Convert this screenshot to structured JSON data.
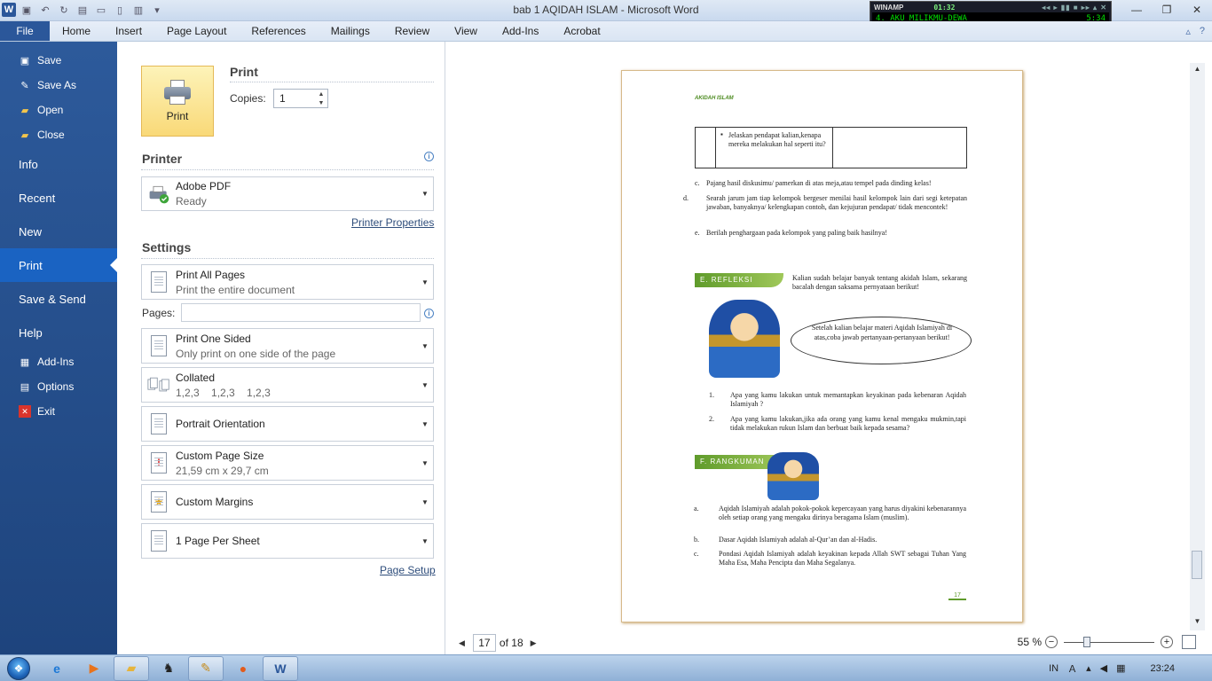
{
  "window": {
    "title": "bab 1 AQIDAH ISLAM  -  Microsoft Word",
    "app_icon": "W"
  },
  "winamp": {
    "label": "WINAMP",
    "time_top": "01:32",
    "track": "4. AKU MILIKMU-DEWA",
    "track_time": "5:34"
  },
  "ribbon": {
    "tabs": [
      "File",
      "Home",
      "Insert",
      "Page Layout",
      "References",
      "Mailings",
      "Review",
      "View",
      "Add-Ins",
      "Acrobat"
    ]
  },
  "nav": {
    "save": "Save",
    "save_as": "Save As",
    "open": "Open",
    "close": "Close",
    "info": "Info",
    "recent": "Recent",
    "new": "New",
    "print": "Print",
    "save_send": "Save & Send",
    "help": "Help",
    "add_ins": "Add-Ins",
    "options": "Options",
    "exit": "Exit"
  },
  "print": {
    "heading": "Print",
    "button_label": "Print",
    "copies_label": "Copies:",
    "copies_value": "1"
  },
  "printer": {
    "heading": "Printer",
    "name": "Adobe PDF",
    "status": "Ready",
    "properties_link": "Printer Properties"
  },
  "settings": {
    "heading": "Settings",
    "range_main": "Print All Pages",
    "range_sub": "Print the entire document",
    "pages_label": "Pages:",
    "pages_value": "",
    "sides_main": "Print One Sided",
    "sides_sub": "Only print on one side of the page",
    "collate_main": "Collated",
    "collate_sub": "1,2,3    1,2,3    1,2,3",
    "orientation_main": "Portrait Orientation",
    "size_main": "Custom Page Size",
    "size_sub": "21,59 cm x 29,7 cm",
    "margins_main": "Custom Margins",
    "persheet_main": "1 Page Per Sheet",
    "page_setup_link": "Page Setup"
  },
  "preview_page": {
    "header": "AKIDAH ISLAM",
    "table_cell": "Jelaskan pendapat kalian,kenapa mereka melakukan hal seperti itu?",
    "items": [
      {
        "m": "c.",
        "t": "Pajang hasil diskusimu/ pamerkan di atas meja,atau tempel pada dinding kelas!"
      },
      {
        "m": "d.",
        "t": "Searah jarum jam tiap kelompok bergeser menilai hasil kelompok lain dari segi ketepatan jawaban, banyaknya/ kelengkapan contoh, dan kejujuran pendapat/ tidak mencontek!"
      },
      {
        "m": "e.",
        "t": "Berilah penghargaan pada kelompok yang paling baik hasilnya!"
      }
    ],
    "refleksi_banner": "E. REFLEKSI",
    "refleksi_text": "Kalian sudah belajar banyak tentang akidah Islam, sekarang bacalah dengan saksama pernyataan berikut!",
    "bubble": "Setelah kalian belajar materi Aqidah Islamiyah di atas,coba jawab pertanyaan-pertanyaan berikut!",
    "questions": [
      {
        "n": "1.",
        "t": "Apa yang kamu lakukan untuk memantapkan keyakinan pada kebenaran Aqidah Islamiyah ?"
      },
      {
        "n": "2.",
        "t": "Apa yang kamu lakukan,jika ada orang yang kamu kenal mengaku mukmin,tapi tidak melakukan rukun Islam dan berbuat  baik kepada sesama?"
      }
    ],
    "rangkuman_banner": "F. RANGKUMAN",
    "summary": [
      {
        "m": "a.",
        "t": "Aqidah Islamiyah adalah pokok-pokok kepercayaan yang harus diyakini kebenarannya oleh setiap orang yang mengaku dirinya beragama Islam (muslim)."
      },
      {
        "m": "b.",
        "t": "Dasar Aqidah Islamiyah adalah al-Qur’an dan al-Hadis."
      },
      {
        "m": "c.",
        "t": "Pondasi Aqidah Islamiyah adalah keyakinan kepada Allah SWT sebagai Tuhan Yang Maha Esa, Maha Pencipta dan Maha Segalanya."
      }
    ],
    "page_number": "17"
  },
  "page_nav": {
    "current": "17",
    "of_total": "of 18"
  },
  "zoom": {
    "label": "55 %",
    "percent": 55
  },
  "taskbar": {
    "lang": "IN",
    "clock": "23:24"
  },
  "colors": {
    "file_tab": "#2b579a",
    "nav_bg": "#1e447d",
    "nav_active": "#1a63c2",
    "print_button": "#f9d978",
    "doc_accent": "#5f9b2b"
  }
}
